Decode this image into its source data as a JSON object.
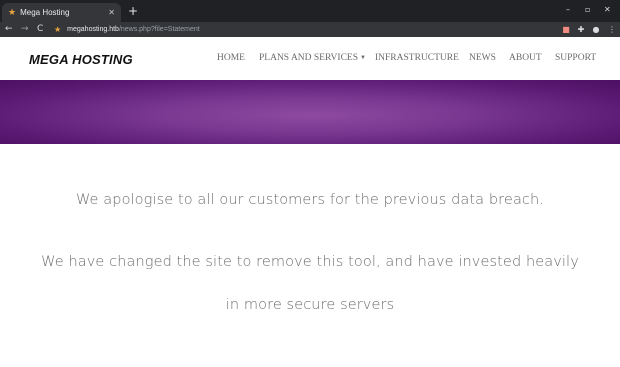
{
  "browser": {
    "tab_title": "Mega Hosting",
    "new_tab_symbol": "+",
    "url_host": "megahosting.htb",
    "url_path": "/news.php?file=Statement",
    "icons": {
      "tab_favicon": "star-icon",
      "back": "arrow-left-icon",
      "forward": "arrow-right-icon",
      "reload": "reload-icon",
      "bookmark": "star-icon",
      "extension": "extension-icon",
      "puzzle": "puzzle-icon",
      "profile": "profile-icon",
      "menu": "kebab-menu-icon"
    }
  },
  "site": {
    "logo": "MEGA HOSTING",
    "nav": {
      "home": "HOME",
      "plans": "PLANS AND SERVICES",
      "infrastructure": "INFRASTRUCTURE",
      "news": "NEWS",
      "about": "ABOUT",
      "support": "SUPPORT"
    },
    "banner_color": "#7a3892"
  },
  "content": {
    "line1": "We apologise to all our customers for the previous data breach.",
    "line2": "We have changed the site to remove this tool, and have invested heavily",
    "line3": "in more secure servers"
  }
}
